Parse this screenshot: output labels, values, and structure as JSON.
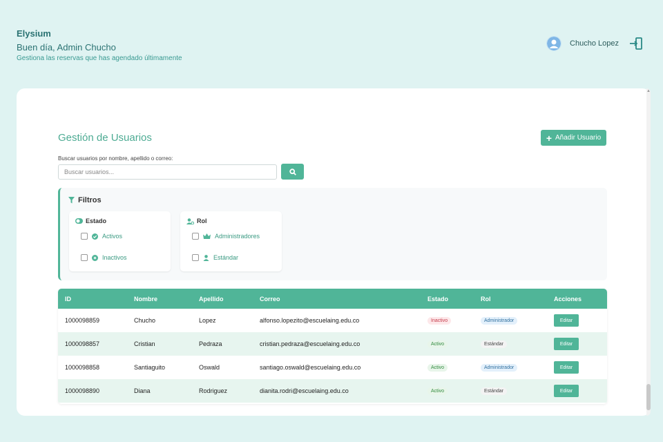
{
  "header": {
    "app_title": "Elysium",
    "greeting": "Buen día, Admin Chucho",
    "subtitle": "Gestiona las reservas que has agendado últimamente",
    "user_name": "Chucho Lopez",
    "avatar_icon": "user-avatar-icon",
    "logout_icon": "logout-icon"
  },
  "main": {
    "title": "Gestión de Usuarios",
    "add_button": "Añadir Usuario",
    "search_label": "Buscar usuarios por nombre, apellido o correo:",
    "search_placeholder": "Buscar usuarios...",
    "search_icon": "search-icon"
  },
  "filters": {
    "title": "Filtros",
    "estado": {
      "title": "Estado",
      "options": [
        "Activos",
        "Inactivos"
      ]
    },
    "rol": {
      "title": "Rol",
      "options": [
        "Administradores",
        "Estándar"
      ]
    }
  },
  "table": {
    "columns": [
      "ID",
      "Nombre",
      "Apellido",
      "Correo",
      "Estado",
      "Rol",
      "Acciones"
    ],
    "rows": [
      {
        "id": "1000098859",
        "nombre": "Chucho",
        "apellido": "Lopez",
        "correo": "alfonso.lopezito@escuelaing.edu.co",
        "estado": "Inactivo",
        "rol": "Administrador",
        "accion": "Editar"
      },
      {
        "id": "1000098857",
        "nombre": "Cristian",
        "apellido": "Pedraza",
        "correo": "cristian.pedraza@escuelaing.edu.co",
        "estado": "Activo",
        "rol": "Estándar",
        "accion": "Editar"
      },
      {
        "id": "1000098858",
        "nombre": "Santiaguito",
        "apellido": "Oswald",
        "correo": "santiago.oswald@escuelaing.edu.co",
        "estado": "Activo",
        "rol": "Administrador",
        "accion": "Editar"
      },
      {
        "id": "1000098890",
        "nombre": "Diana",
        "apellido": "Rodriguez",
        "correo": "dianita.rodri@escuelaing.edu.co",
        "estado": "Activo",
        "rol": "Estándar",
        "accion": "Editar"
      }
    ]
  },
  "colors": {
    "accent": "#50b598",
    "background": "#dff3f2",
    "title_text": "#2a7272"
  }
}
